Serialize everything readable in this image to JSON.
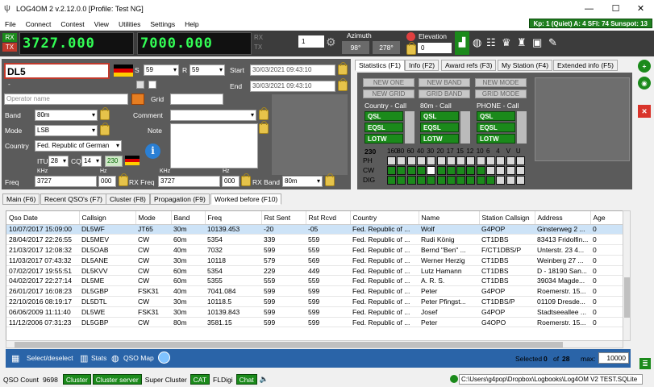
{
  "title": "LOG4OM 2 v.2.12.0.0 [Profile: Test NG]",
  "window_controls": {
    "minimize": "—",
    "maximize": "☐",
    "close": "✕"
  },
  "menu": [
    "File",
    "Connect",
    "Contest",
    "View",
    "Utilities",
    "Settings",
    "Help"
  ],
  "kp_badge": "Kp: 1 (Quiet)  A: 4  SFI: 74  Sunspot: 13",
  "radio": {
    "rx_tag": "RX",
    "tx_tag": "TX",
    "rx_freq": "3727.000",
    "tx_freq": "7000.000",
    "rx_label": "RX",
    "tx_label": "TX",
    "vfo": "1",
    "azimuth_label": "Azimuth",
    "azimuth_short": "98°",
    "azimuth_long": "278°",
    "elevation_label": "Elevation",
    "elevation": "0"
  },
  "qso": {
    "callsign": "DL5",
    "s_label": "S",
    "s_value": "59",
    "r_label": "R",
    "r_value": "59",
    "start_label": "Start",
    "start_value": "30/03/2021 09:43:10",
    "end_label": "End",
    "end_value": "30/03/2021 09:43:10",
    "dash": "-",
    "operator_placeholder": "Operator name",
    "grid_label": "Grid",
    "band_label": "Band",
    "band_value": "80m",
    "comment_label": "Comment",
    "mode_label": "Mode",
    "mode_value": "LSB",
    "note_label": "Note",
    "country_label": "Country",
    "country_value": "Fed. Republic of German",
    "itu_label": "ITU",
    "itu_value": "28",
    "cq_label": "CQ",
    "cq_value": "14",
    "dxcc": "230",
    "khz_label": "KHz",
    "hz_label": "Hz",
    "freq_label": "Freq",
    "freq_khz": "3727",
    "freq_hz": "000",
    "rxfreq_label": "RX Freq",
    "rxfreq_khz": "3727",
    "rxfreq_hz": "000",
    "rxband_label": "RX Band",
    "rxband_value": "80m"
  },
  "stats": {
    "tabs": [
      "Statistics (F1)",
      "Info (F2)",
      "Award refs (F3)",
      "My Station (F4)",
      "Extended info (F5)"
    ],
    "buttons_row1": [
      "NEW ONE",
      "NEW BAND",
      "NEW MODE"
    ],
    "buttons_row2": [
      "NEW GRID",
      "GRID BAND",
      "GRID MODE"
    ],
    "group_titles": [
      "Country - Call",
      "80m - Call",
      "PHONE - Call"
    ],
    "confirm_labels": [
      "QSL",
      "EQSL",
      "LOTW"
    ],
    "dxcc": "230",
    "bands": [
      "160",
      "80",
      "60",
      "40",
      "30",
      "20",
      "17",
      "15",
      "12",
      "10",
      "6",
      "4",
      "V",
      "U"
    ],
    "modes": [
      "PH",
      "CW",
      "DIG"
    ]
  },
  "lower_tabs": [
    "Main (F6)",
    "Recent QSO's (F7)",
    "Cluster (F8)",
    "Propagation (F9)",
    "Worked before (F10)"
  ],
  "table": {
    "columns": [
      "Qso Date",
      "Callsign",
      "Mode",
      "Band",
      "Freq",
      "Rst Sent",
      "Rst Rcvd",
      "Country",
      "Name",
      "Station Callsign",
      "Address",
      "Age"
    ],
    "rows": [
      [
        "10/07/2017 15:09:00",
        "DL5WF",
        "JT65",
        "30m",
        "10139.453",
        "-20",
        "-05",
        "Fed. Republic of ...",
        "Wolf",
        "G4POP",
        "Ginsterweg 2 ...",
        "0"
      ],
      [
        "28/04/2017 22:26:55",
        "DL5MEV",
        "CW",
        "60m",
        "5354",
        "339",
        "559",
        "Fed. Republic of ...",
        "Rudi König",
        "CT1DBS",
        "83413 Fridolfin...",
        "0"
      ],
      [
        "21/03/2017 12:08:32",
        "DL5OAB",
        "CW",
        "40m",
        "7032",
        "599",
        "559",
        "Fed. Republic of ...",
        "Bernd \"Ben\" ...",
        "F/CT1DBS/P",
        "Unterstr. 23 4...",
        "0"
      ],
      [
        "11/03/2017 07:43:32",
        "DL5ANE",
        "CW",
        "30m",
        "10118",
        "579",
        "569",
        "Fed. Republic of ...",
        "Werner Herzig",
        "CT1DBS",
        "Weinberg 27 ...",
        "0"
      ],
      [
        "07/02/2017 19:55:51",
        "DL5KVV",
        "CW",
        "60m",
        "5354",
        "229",
        "449",
        "Fed. Republic of ...",
        "Lutz Hamann",
        "CT1DBS",
        "D - 18190 San...",
        "0"
      ],
      [
        "04/02/2017 22:27:14",
        "DL5ME",
        "CW",
        "60m",
        "5355",
        "559",
        "559",
        "Fed. Republic of ...",
        "A. R. S.",
        "CT1DBS",
        "39034 Magde...",
        "0"
      ],
      [
        "26/01/2017 16:08:23",
        "DL5GBP",
        "FSK31",
        "40m",
        "7041.084",
        "599",
        "599",
        "Fed. Republic of ...",
        "Peter",
        "G4POP",
        "Roemerstr. 15...",
        "0"
      ],
      [
        "22/10/2016 08:19:17",
        "DL5DTL",
        "CW",
        "30m",
        "10118.5",
        "599",
        "599",
        "Fed. Republic of ...",
        "Peter Pfingst...",
        "CT1DBS/P",
        "01109 Dresde...",
        "0"
      ],
      [
        "06/06/2009 11:11:40",
        "DL5WE",
        "FSK31",
        "30m",
        "10139.843",
        "599",
        "599",
        "Fed. Republic of ...",
        "Josef",
        "G4POP",
        "Stadtseeallee ...",
        "0"
      ],
      [
        "11/12/2006 07:31:23",
        "DL5GBP",
        "CW",
        "80m",
        "3581.15",
        "599",
        "599",
        "Fed. Republic of ...",
        "Peter",
        "G4OPO",
        "Roemerstr. 15...",
        "0"
      ]
    ]
  },
  "footer": {
    "select_label": "Select/deselect",
    "stats_label": "Stats",
    "qsomap_label": "QSO Map",
    "selected_label": "Selected",
    "selected_count": "0",
    "of_label": "of",
    "total_count": "28",
    "max_label": "max:",
    "max_value": "10000"
  },
  "status": {
    "qso_count_label": "QSO Count",
    "qso_count": "9698",
    "cluster": "Cluster",
    "cluster_server": "Cluster server",
    "super_cluster": "Super Cluster",
    "cat": "CAT",
    "fldigi": "FLDigi",
    "chat": "Chat",
    "db_path": "C:\\Users\\g4pop\\Dropbox\\Logbooks\\Log4OM V2 TEST.SQLite"
  },
  "colors": {
    "led_green": "#33ff55",
    "confirm_green": "#1b8a1b",
    "kp_green": "#1f7f1f",
    "band_blue": "#2a64a8"
  }
}
